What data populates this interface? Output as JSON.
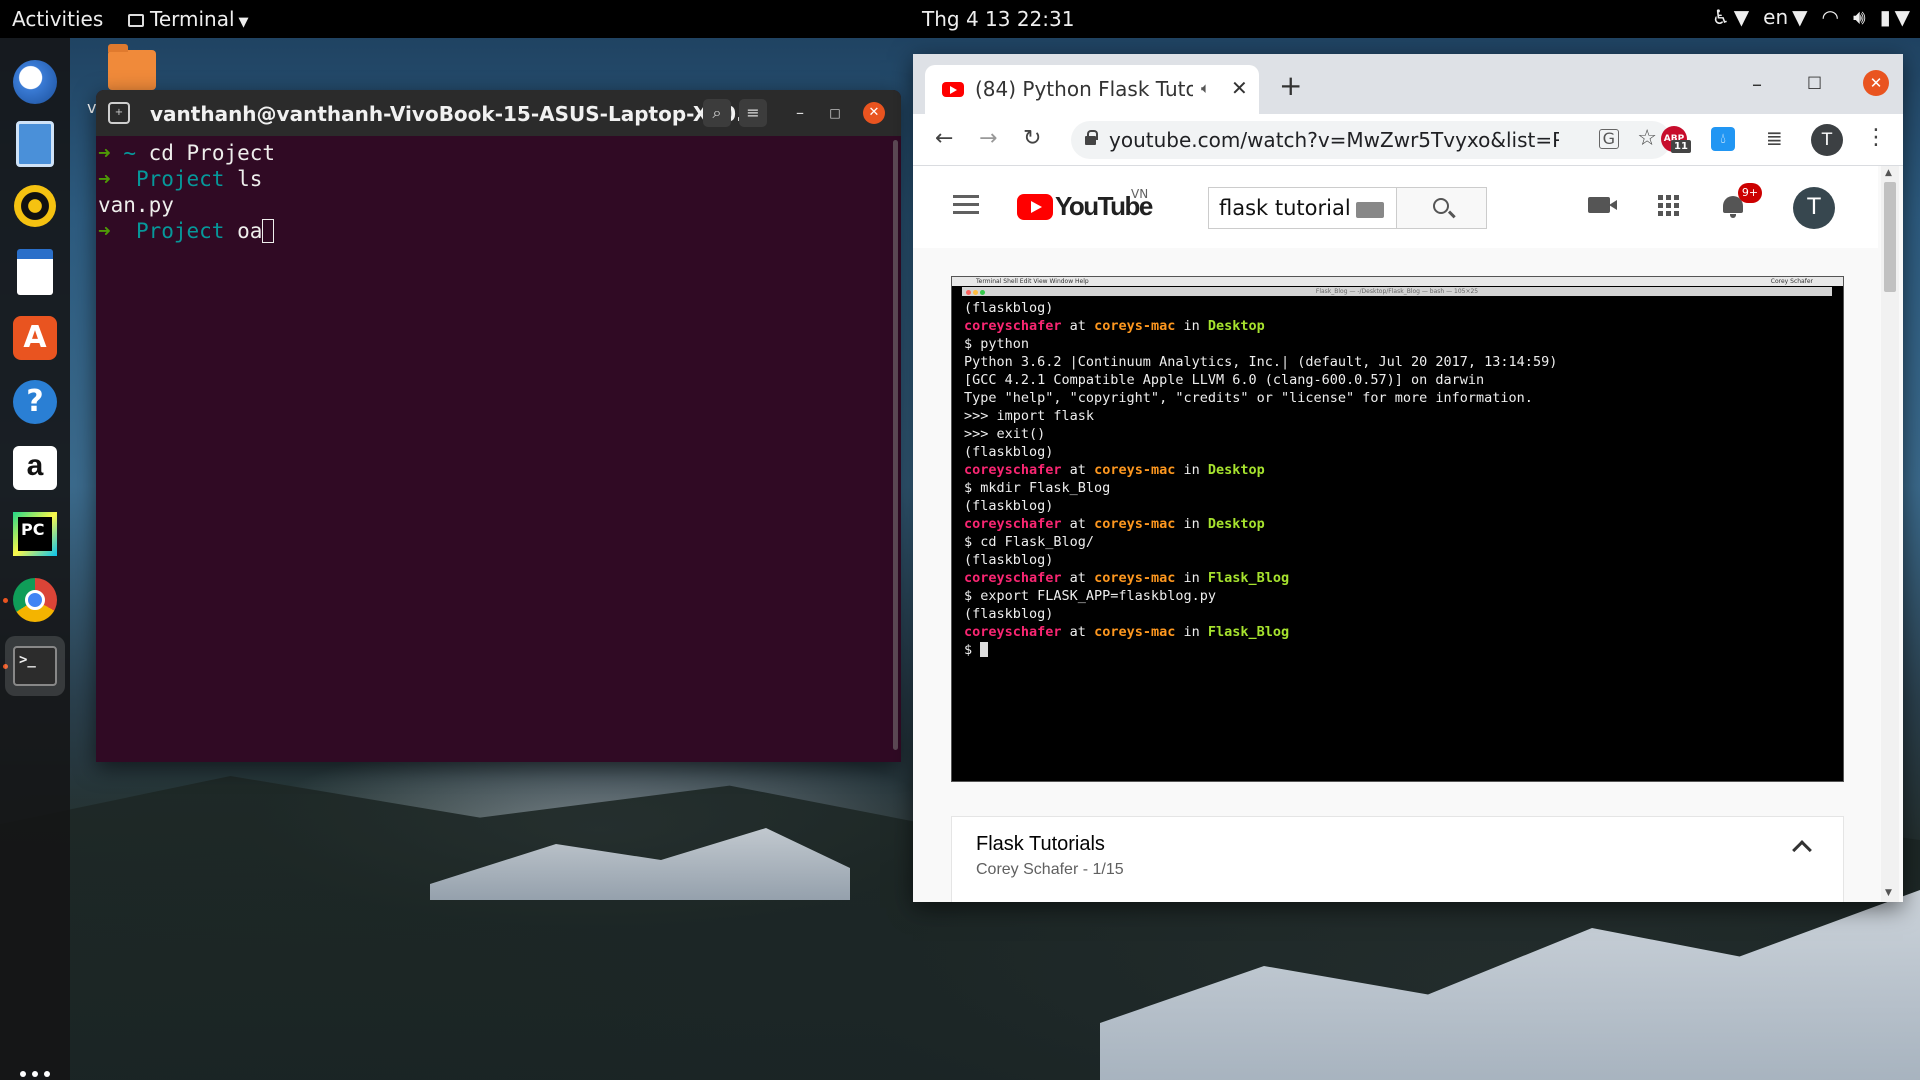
{
  "topbar": {
    "activities": "Activities",
    "app_name": "Terminal",
    "clock": "Thg 4 13  22:31",
    "language": "en"
  },
  "dock": {
    "items": [
      {
        "name": "thunderbird-icon"
      },
      {
        "name": "files-icon"
      },
      {
        "name": "rhythmbox-icon"
      },
      {
        "name": "writer-icon"
      },
      {
        "name": "software-center-icon",
        "glyph": "A"
      },
      {
        "name": "help-icon",
        "glyph": "?"
      },
      {
        "name": "amazon-icon",
        "glyph": "a"
      },
      {
        "name": "pycharm-icon",
        "glyph": "PC"
      },
      {
        "name": "chrome-icon"
      },
      {
        "name": "terminal-icon",
        "glyph": ">_"
      }
    ]
  },
  "desktop": {
    "folder_label_fragment": "v"
  },
  "terminal": {
    "title": "vanthanh@vanthanh-VivoBook-15-ASUS-Laptop-X50...",
    "lines": [
      {
        "arrow": "➜",
        "dir": "~",
        "cmd": " cd Project"
      },
      {
        "arrow": "➜",
        "dir": "Project",
        "cmd": " ls"
      },
      {
        "output": "van.py"
      },
      {
        "arrow": "➜",
        "dir": "Project",
        "cmd": " oa"
      }
    ]
  },
  "chrome": {
    "tab_title": "(84) Python Flask Tuto",
    "url": "youtube.com/watch?v=MwZwr5Tvyxo&list=P...",
    "abp_badge": "11",
    "profile_initial": "T"
  },
  "youtube": {
    "logo_text": "YouTube",
    "region": "VN",
    "search_value": "flask tutorial",
    "notif_count": "9+",
    "avatar_initial": "T",
    "playlist_title": "Flask Tutorials",
    "playlist_sub": "Corey Schafer - 1/15"
  },
  "video_terminal": {
    "menubar": "Terminal   Shell   Edit   View   Window   Help",
    "titlebar": "Flask_Blog — -/Desktop/Flask_Blog — bash — 105×25",
    "menubar_right": "Corey Schafer",
    "lines": [
      {
        "t": "(flaskblog)"
      },
      {
        "prompt": true,
        "user": "coreyschafer",
        "at": " at ",
        "host": "coreys-mac",
        "in": " in ",
        "dir": "Desktop"
      },
      {
        "t": "$ python"
      },
      {
        "t": "Python 3.6.2 |Continuum Analytics, Inc.| (default, Jul 20 2017, 13:14:59)"
      },
      {
        "t": "[GCC 4.2.1 Compatible Apple LLVM 6.0 (clang-600.0.57)] on darwin"
      },
      {
        "t": "Type \"help\", \"copyright\", \"credits\" or \"license\" for more information."
      },
      {
        "t": ">>> import flask"
      },
      {
        "t": ">>> exit()"
      },
      {
        "t": "(flaskblog)"
      },
      {
        "prompt": true,
        "user": "coreyschafer",
        "at": " at ",
        "host": "coreys-mac",
        "in": " in ",
        "dir": "Desktop"
      },
      {
        "t": "$ mkdir Flask_Blog"
      },
      {
        "t": "(flaskblog)"
      },
      {
        "prompt": true,
        "user": "coreyschafer",
        "at": " at ",
        "host": "coreys-mac",
        "in": " in ",
        "dir": "Desktop"
      },
      {
        "t": "$ cd Flask_Blog/"
      },
      {
        "t": "(flaskblog)"
      },
      {
        "prompt": true,
        "user": "coreyschafer",
        "at": " at ",
        "host": "coreys-mac",
        "in": " in ",
        "dir": "Flask_Blog"
      },
      {
        "t": "$ export FLASK_APP=flaskblog.py"
      },
      {
        "t": "(flaskblog)"
      },
      {
        "prompt": true,
        "user": "coreyschafer",
        "at": " at ",
        "host": "coreys-mac",
        "in": " in ",
        "dir": "Flask_Blog"
      },
      {
        "t": "$ ",
        "cursor": true
      }
    ]
  },
  "colors": {
    "terminal_bg": "#300a24",
    "ubuntu_orange": "#e95420",
    "youtube_red": "#ff0000"
  }
}
